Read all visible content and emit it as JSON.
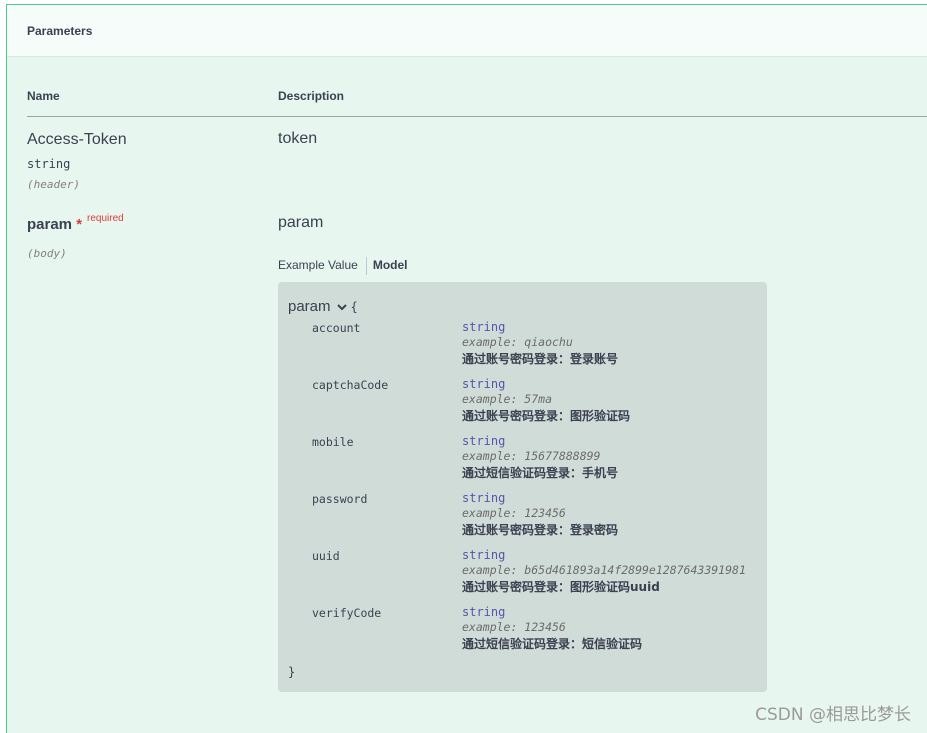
{
  "section_title": "Parameters",
  "columns": {
    "name": "Name",
    "description": "Description"
  },
  "params": [
    {
      "name": "Access-Token",
      "type": "string",
      "in": "(header)",
      "description": "token"
    },
    {
      "name": "param",
      "required_star": "*",
      "required_label": "required",
      "in": "(body)",
      "description": "param"
    }
  ],
  "tabs": {
    "example": "Example Value",
    "model": "Model"
  },
  "model": {
    "title": "param",
    "open_brace": "{",
    "close_brace": "}",
    "properties": [
      {
        "name": "account",
        "type": "string",
        "example": "example: qiaochu",
        "desc": "通过账号密码登录：登录账号"
      },
      {
        "name": "captchaCode",
        "type": "string",
        "example": "example: 57ma",
        "desc": "通过账号密码登录：图形验证码"
      },
      {
        "name": "mobile",
        "type": "string",
        "example": "example: 15677888899",
        "desc": "通过短信验证码登录：手机号"
      },
      {
        "name": "password",
        "type": "string",
        "example": "example: 123456",
        "desc": "通过账号密码登录：登录密码"
      },
      {
        "name": "uuid",
        "type": "string",
        "example": "example: b65d461893a14f2899e1287643391981",
        "desc": "通过账号密码登录：图形验证码uuid"
      },
      {
        "name": "verifyCode",
        "type": "string",
        "example": "example: 123456",
        "desc": "通过短信验证码登录：短信验证码"
      }
    ]
  },
  "watermark": "CSDN @相思比梦长"
}
